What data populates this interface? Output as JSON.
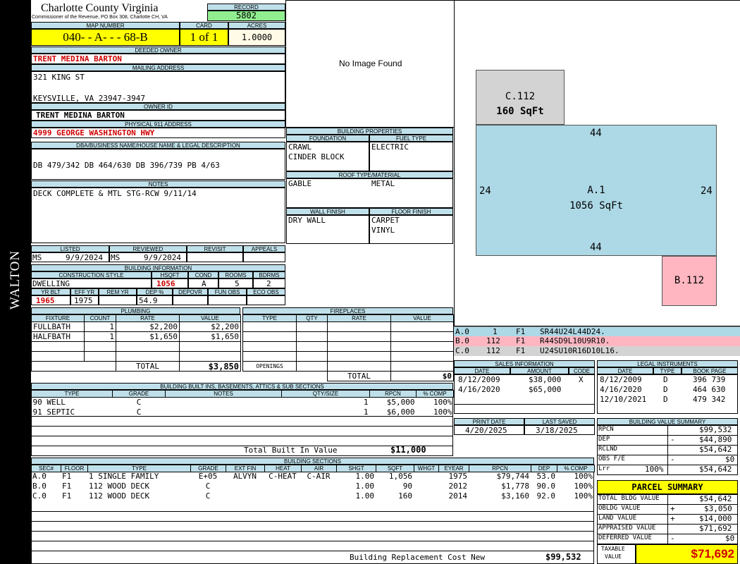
{
  "sidebar": {
    "district": "WALTON"
  },
  "header": {
    "county": "Charlotte County Virginia",
    "commissioner": "Commissioner of the Revenue, PO Box 308, Charlotte CH, VA",
    "record_label": "RECORD",
    "record": "5802",
    "map_label": "MAP NUMBER",
    "map_number": "040- - A- - - 68-B",
    "card_label": "CARD",
    "card": "1 of 1",
    "acres_label": "ACRES",
    "acres": "1.0000"
  },
  "owner": {
    "deeded_label": "DEEDED OWNER",
    "deeded_owner": "TRENT MEDINA BARTON",
    "mailing_label": "MAILING ADDRESS",
    "address1": "321 KING ST",
    "address2": "KEYSVILLE, VA 23947-3947",
    "owner_id_label": "OWNER ID",
    "owner_id": "TRENT MEDINA BARTON",
    "physical_label": "PHYSICAL 911 ADDRESS",
    "physical": "4999 GEORGE WASHINGTON  HWY"
  },
  "legal": {
    "label": "DBA/BUSINESS NAME/HOUSE NAME & LEGAL DESCRIPTION",
    "text": "DB 479/342 DB 464/630 DB 396/739 PB 4/63"
  },
  "notes": {
    "label": "NOTES",
    "text": "DECK COMPLETE & MTL STG-RCW 9/11/14"
  },
  "photo": {
    "text": "No Image Found"
  },
  "building_props": {
    "label": "BUILDING PROPERTIES",
    "foundation_label": "FOUNDATION",
    "fuel_label": "FUEL TYPE",
    "foundation1": "CRAWL",
    "foundation2": "CINDER BLOCK",
    "fuel": "ELECTRIC",
    "roof_label": "ROOF TYPE/MATERIAL",
    "roof_type": "GABLE",
    "roof_material": "METAL",
    "wall_label": "WALL FINISH",
    "floor_label": "FLOOR FINISH",
    "wall": "DRY WALL",
    "floor1": "CARPET",
    "floor2": "VINYL"
  },
  "review": {
    "listed_label": "LISTED",
    "reviewed_label": "REVIEWED",
    "revisit_label": "REVISIT",
    "appeals_label": "APPEALS",
    "listed_by": "MS",
    "listed_date": "9/9/2024",
    "reviewed_by": "MS",
    "reviewed_date": "9/9/2024"
  },
  "building_info": {
    "label": "BUILDING INFORMATION",
    "style_label": "CONSTRUCTION STYLE",
    "hsqft_label": "HSQFT",
    "cond_label": "COND",
    "rooms_label": "ROOMS",
    "bdrms_label": "BDRMS",
    "style": "DWELLING",
    "hsqft": "1056",
    "cond": "A",
    "rooms": "5",
    "bdrms": "2",
    "yrblt_label": "YR BLT",
    "effyr_label": "EFF YR",
    "remyr_label": "REM YR",
    "dep_label": "DEP %",
    "depovr_label": "DEPOVR",
    "funobs_label": "FUN OBS",
    "ecoobs_label": "ECO OBS",
    "yrblt": "1965",
    "effyr": "1975",
    "remyr": "",
    "dep": "54.9"
  },
  "plumbing": {
    "label": "PLUMBING",
    "headers": [
      "FIXTURE",
      "COUNT",
      "RATE",
      "VALUE"
    ],
    "rows": [
      [
        "FULLBATH",
        "1",
        "$2,200",
        "$2,200"
      ],
      [
        "HALFBATH",
        "1",
        "$1,650",
        "$1,650"
      ]
    ],
    "total_label": "TOTAL",
    "total": "$3,850"
  },
  "fireplaces": {
    "label": "FIREPLACES",
    "headers": [
      "TYPE",
      "QTY",
      "RATE",
      "VALUE"
    ],
    "openings_label": "OPENINGS",
    "total_label": "TOTAL",
    "total": "$0"
  },
  "builtins": {
    "label": "BUILDING BUILT INS, BASEMENTS, ATTICS & SUB SECTIONS",
    "headers": [
      "TYPE",
      "GRADE",
      "NOTES",
      "QTY/SIZE",
      "RPCN",
      "% COMP"
    ],
    "rows": [
      [
        "90 WELL",
        "C",
        "",
        "1",
        "$5,000",
        "100%"
      ],
      [
        "91 SEPTIC",
        "C",
        "",
        "1",
        "$6,000",
        "100%"
      ]
    ],
    "total_label": "Total Built In Value",
    "total": "$11,000"
  },
  "sections": {
    "label": "BUILDING SECTIONS",
    "headers": [
      "SEC#",
      "FLOOR",
      "TYPE",
      "GRADE",
      "EXT FIN",
      "HEAT",
      "AIR",
      "SHGT",
      "SQFT",
      "WHGT",
      "EYEAR",
      "RPCN",
      "DEP",
      "% COMP"
    ],
    "rows": [
      [
        "A.0",
        "F1",
        "1 SINGLE FAMILY",
        "E+05",
        "ALVYN",
        "C-HEAT",
        "C-AIR",
        "1.00",
        "1,056",
        "",
        "1975",
        "$79,744",
        "53.0",
        "100%"
      ],
      [
        "B.0",
        "F1",
        "112 WOOD DECK",
        "C",
        "",
        "",
        "",
        "1.00",
        "90",
        "",
        "2012",
        "$1,778",
        "90.0",
        "100%"
      ],
      [
        "C.0",
        "F1",
        "112 WOOD DECK",
        "C",
        "",
        "",
        "",
        "1.00",
        "160",
        "",
        "2014",
        "$3,160",
        "92.0",
        "100%"
      ]
    ],
    "brcn_label": "Building Replacement Cost New",
    "brcn": "$99,532"
  },
  "sketch": {
    "c_label": "C.112",
    "c_area": "160 SqFt",
    "a_label": "A.1",
    "a_area": "1056 SqFt",
    "b_label": "B.112",
    "dim_top": "44",
    "dim_bottom": "44",
    "dim_left": "24",
    "dim_right": "24",
    "colors": {
      "a": "#add8e6",
      "b": "#ffb6c1",
      "c": "#d3d3d3"
    }
  },
  "vectors": [
    {
      "sec": "A.0",
      "code": "1",
      "floor": "F1",
      "path": "SR44U24L44D24."
    },
    {
      "sec": "B.0",
      "code": "112",
      "floor": "F1",
      "path": "R44SD9L10U9R10."
    },
    {
      "sec": "C.0",
      "code": "112",
      "floor": "F1",
      "path": "U24SU10R16D10L16."
    }
  ],
  "sales": {
    "label": "SALES INFORMATION",
    "headers": [
      "DATE",
      "AMOUNT",
      "CODE"
    ],
    "rows": [
      [
        "8/12/2009",
        "$38,000",
        "X"
      ],
      [
        "4/16/2020",
        "$65,000",
        ""
      ]
    ]
  },
  "instruments": {
    "label": "LEGAL INSTRUMENTS",
    "headers": [
      "DATE",
      "TYPE",
      "BOOK PAGE"
    ],
    "rows": [
      [
        "8/12/2009",
        "D",
        "396 739"
      ],
      [
        "4/16/2020",
        "D",
        "464 630"
      ],
      [
        "12/10/2021",
        "D",
        "479 342"
      ]
    ]
  },
  "dates": {
    "print_label": "PRINT DATE",
    "saved_label": "LAST SAVED",
    "print_date": "4/20/2025",
    "last_saved": "3/18/2025"
  },
  "value_summary": {
    "label": "BUILDING VALUE SUMMARY",
    "rpcn_label": "RPCN",
    "rpcn": "$99,532",
    "dep_label": "DEP",
    "dep_sign": "-",
    "dep": "$44,890",
    "rclnd_label": "RCLND",
    "rclnd": "$54,642",
    "obs_label": "OBS F/E",
    "obs_sign": "-",
    "obs": "$0",
    "lrr_label": "Lrr",
    "lrr_pct": "100%",
    "lrr": "$54,642"
  },
  "parcel": {
    "label": "PARCEL SUMMARY",
    "bldg_label": "TOTAL BLDG VALUE",
    "bldg": "$54,642",
    "obldg_label": "OBLDG VALUE",
    "obldg_sign": "+",
    "obldg": "$3,050",
    "land_label": "LAND VALUE",
    "land_sign": "+",
    "land": "$14,000",
    "appraised_label": "APPRAISED VALUE",
    "appraised": "$71,692",
    "deferred_label": "DEFERRED VALUE",
    "deferred_sign": "-",
    "deferred": "$0",
    "taxable_label1": "TAXABLE",
    "taxable_label2": "VALUE",
    "taxable": "$71,692"
  }
}
